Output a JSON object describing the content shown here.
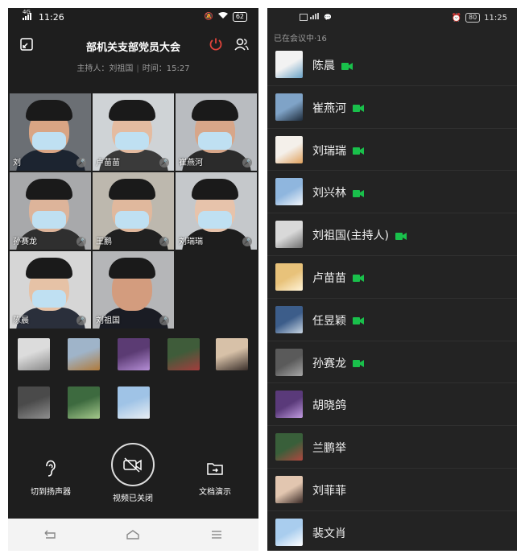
{
  "left": {
    "status": {
      "network": "4G",
      "time": "11:26",
      "battery": "62"
    },
    "meeting": {
      "title": "部机关支部党员大会",
      "host": "主持人：刘祖国",
      "duration": "时间：15:27"
    },
    "tiles": [
      {
        "name": "刘",
        "bg": "#6b6f74",
        "skin": "#d9a584",
        "body": "#1c2430",
        "masked": true
      },
      {
        "name": "卢苗苗",
        "bg": "#cfd3d6",
        "skin": "#e4bba0",
        "body": "#3a3a3a",
        "masked": true
      },
      {
        "name": "崔燕河",
        "bg": "#b9bcc0",
        "skin": "#d7a689",
        "body": "#2b2b2b",
        "masked": true
      },
      {
        "name": "孙赛龙",
        "bg": "#a8a9ab",
        "skin": "#ddb49a",
        "body": "#2f2f2f",
        "masked": true
      },
      {
        "name": "王鹏",
        "bg": "#bdb8ae",
        "skin": "#e0b89d",
        "body": "#202020",
        "masked": true
      },
      {
        "name": "刘瑞瑞",
        "bg": "#c5c8cb",
        "skin": "#e7c3ab",
        "body": "#1d1d1d",
        "masked": true
      },
      {
        "name": "陈晨",
        "bg": "#d6d6d6",
        "skin": "#e6c2a6",
        "body": "#2a2f3b",
        "masked": true
      },
      {
        "name": "刘祖国",
        "bg": "#b5b6b8",
        "skin": "#d39c7e",
        "body": "#1a1c24",
        "masked": false
      }
    ],
    "thumbs": [
      {
        "c1": "#dcdcdc",
        "c2": "#8a8a8a"
      },
      {
        "c1": "#9fb4c9",
        "c2": "#b07a3a"
      },
      {
        "c1": "#5b3b73",
        "c2": "#b58ed6"
      },
      {
        "c1": "#3f5c3a",
        "c2": "#a33d3d"
      },
      {
        "c1": "#d7c1a8",
        "c2": "#3a2f2b"
      },
      {
        "c1": "#4a4a4a",
        "c2": "#8f8f8f"
      },
      {
        "c1": "#3d6a3f",
        "c2": "#a5c98c"
      },
      {
        "c1": "#9fc3e6",
        "c2": "#e9eef3"
      }
    ],
    "controls": {
      "speaker": "切到扬声器",
      "video": "视频已关闭",
      "docs": "文档演示"
    }
  },
  "right": {
    "status": {
      "time": "11:25",
      "battery": "80"
    },
    "count_label": "已在会议中·16",
    "accent": "#19c04b",
    "participants": [
      {
        "name": "陈晨",
        "video": true,
        "c1": "#f2f2f2",
        "c2": "#6aa2c6"
      },
      {
        "name": "崔燕河",
        "video": true,
        "c1": "#7fa3c7",
        "c2": "#1e2b3a"
      },
      {
        "name": "刘瑞瑞",
        "video": true,
        "c1": "#f4f0ea",
        "c2": "#e0a15d"
      },
      {
        "name": "刘兴林",
        "video": true,
        "c1": "#8fb6de",
        "c2": "#f2f6fa"
      },
      {
        "name": "刘祖国(主持人)",
        "video": true,
        "c1": "#d9d9d9",
        "c2": "#6f6f6f"
      },
      {
        "name": "卢苗苗",
        "video": true,
        "c1": "#e8c27a",
        "c2": "#fff4d8"
      },
      {
        "name": "任昱颖",
        "video": true,
        "c1": "#3c5d8a",
        "c2": "#c9d6e3"
      },
      {
        "name": "孙赛龙",
        "video": true,
        "c1": "#5a5a5a",
        "c2": "#a7a7a7"
      },
      {
        "name": "胡晓鸽",
        "video": false,
        "c1": "#5a3a7a",
        "c2": "#c19be0"
      },
      {
        "name": "兰鹏举",
        "video": false,
        "c1": "#395f3a",
        "c2": "#b0473f"
      },
      {
        "name": "刘菲菲",
        "video": false,
        "c1": "#e2c6b0",
        "c2": "#3a2a26"
      },
      {
        "name": "裴文肖",
        "video": false,
        "c1": "#a9cdee",
        "c2": "#ffffff"
      }
    ]
  }
}
